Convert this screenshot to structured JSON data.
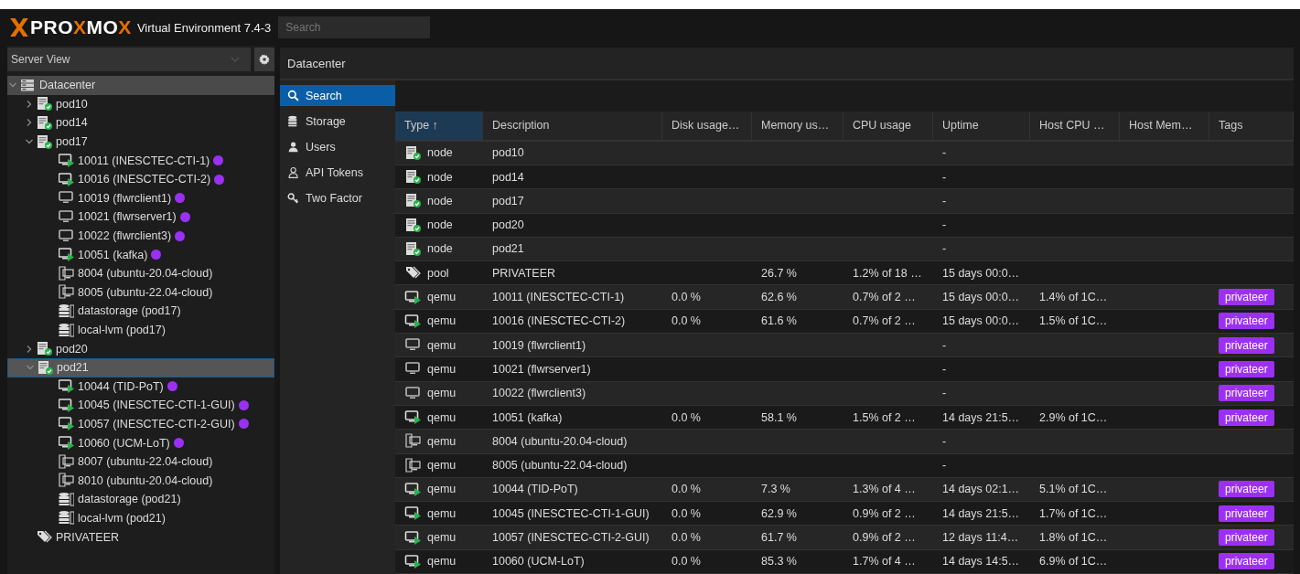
{
  "header": {
    "logo": [
      {
        "text": "PRO",
        "accent": false
      },
      {
        "text": "X",
        "accent": true
      },
      {
        "text": "MO",
        "accent": false
      },
      {
        "text": "X",
        "accent": true
      }
    ],
    "product": "Virtual Environment 7.4-3",
    "search": {
      "placeholder": "Search"
    }
  },
  "sidebar": {
    "view_selector": "Server View",
    "tree": {
      "label": "Datacenter",
      "kind": "datacenter",
      "expanded": true,
      "highlighted": true,
      "children": [
        {
          "label": "pod10",
          "kind": "node",
          "expanded": false,
          "selected": false
        },
        {
          "label": "pod14",
          "kind": "node",
          "expanded": false,
          "selected": false
        },
        {
          "label": "pod17",
          "kind": "node",
          "expanded": true,
          "selected": false,
          "children": [
            {
              "label": "10011 (INESCTEC-CTI-1)",
              "kind": "vm-running",
              "selected": false,
              "tags": [
                {
                  "color": "#9b30f5"
                }
              ]
            },
            {
              "label": "10016 (INESCTEC-CTI-2)",
              "kind": "vm-running",
              "selected": false,
              "tags": [
                {
                  "color": "#9b30f5"
                }
              ]
            },
            {
              "label": "10019 (flwrclient1)",
              "kind": "vm-stopped",
              "selected": false,
              "tags": [
                {
                  "color": "#9b30f5"
                }
              ]
            },
            {
              "label": "10021 (flwrserver1)",
              "kind": "vm-stopped",
              "selected": false,
              "tags": [
                {
                  "color": "#9b30f5"
                }
              ]
            },
            {
              "label": "10022 (flwrclient3)",
              "kind": "vm-stopped",
              "selected": false,
              "tags": [
                {
                  "color": "#9b30f5"
                }
              ]
            },
            {
              "label": "10051 (kafka)",
              "kind": "vm-running",
              "selected": false,
              "tags": [
                {
                  "color": "#9b30f5"
                }
              ]
            },
            {
              "label": "8004 (ubuntu-20.04-cloud)",
              "kind": "template",
              "selected": false
            },
            {
              "label": "8005 (ubuntu-22.04-cloud)",
              "kind": "template",
              "selected": false
            },
            {
              "label": "datastorage (pod17)",
              "kind": "storage",
              "selected": false
            },
            {
              "label": "local-lvm (pod17)",
              "kind": "storage",
              "selected": false
            }
          ]
        },
        {
          "label": "pod20",
          "kind": "node",
          "expanded": false,
          "selected": false
        },
        {
          "label": "pod21",
          "kind": "node",
          "expanded": true,
          "selected": true,
          "children": [
            {
              "label": "10044 (TID-PoT)",
              "kind": "vm-running",
              "selected": false,
              "tags": [
                {
                  "color": "#9b30f5"
                }
              ]
            },
            {
              "label": "10045 (INESCTEC-CTI-1-GUI)",
              "kind": "vm-running",
              "selected": false,
              "tags": [
                {
                  "color": "#9b30f5"
                }
              ]
            },
            {
              "label": "10057 (INESCTEC-CTI-2-GUI)",
              "kind": "vm-running",
              "selected": false,
              "tags": [
                {
                  "color": "#9b30f5"
                }
              ]
            },
            {
              "label": "10060 (UCM-LoT)",
              "kind": "vm-running",
              "selected": false,
              "tags": [
                {
                  "color": "#9b30f5"
                }
              ]
            },
            {
              "label": "8007 (ubuntu-22.04-cloud)",
              "kind": "template",
              "selected": false
            },
            {
              "label": "8010 (ubuntu-20.04-cloud)",
              "kind": "template",
              "selected": false
            },
            {
              "label": "datastorage (pod21)",
              "kind": "storage",
              "selected": false
            },
            {
              "label": "local-lvm (pod21)",
              "kind": "storage",
              "selected": false
            }
          ]
        },
        {
          "label": "PRIVATEER",
          "kind": "pool",
          "selected": false
        }
      ]
    }
  },
  "content": {
    "title": "Datacenter",
    "nav": [
      {
        "label": "Search",
        "kind": "search",
        "selected": true
      },
      {
        "label": "Storage",
        "kind": "storage",
        "selected": false
      },
      {
        "label": "Users",
        "kind": "user",
        "selected": false
      },
      {
        "label": "API Tokens",
        "kind": "token",
        "selected": false
      },
      {
        "label": "Two Factor",
        "kind": "key",
        "selected": false
      }
    ],
    "table": {
      "columns": [
        {
          "label": "Type ↑",
          "sorted": true
        },
        {
          "label": "Description",
          "sorted": false
        },
        {
          "label": "Disk usage…",
          "sorted": false
        },
        {
          "label": "Memory us…",
          "sorted": false
        },
        {
          "label": "CPU usage",
          "sorted": false
        },
        {
          "label": "Uptime",
          "sorted": false
        },
        {
          "label": "Host CPU …",
          "sorted": false
        },
        {
          "label": "Host Mem…",
          "sorted": false
        },
        {
          "label": "Tags",
          "sorted": false
        }
      ],
      "rows": [
        {
          "kind": "node",
          "type": "node",
          "description": "pod10",
          "uptime": "-"
        },
        {
          "kind": "node",
          "type": "node",
          "description": "pod14",
          "uptime": "-"
        },
        {
          "kind": "node",
          "type": "node",
          "description": "pod17",
          "uptime": "-"
        },
        {
          "kind": "node",
          "type": "node",
          "description": "pod20",
          "uptime": "-"
        },
        {
          "kind": "node",
          "type": "node",
          "description": "pod21",
          "uptime": "-"
        },
        {
          "kind": "pool",
          "type": "pool",
          "description": "PRIVATEER",
          "memory": "26.7 %",
          "cpu": "1.2% of 18 …",
          "uptime": "15 days 00:0…"
        },
        {
          "kind": "vm-running",
          "type": "qemu",
          "description": "10011 (INESCTEC-CTI-1)",
          "disk": "0.0 %",
          "memory": "62.6 %",
          "cpu": "0.7% of 2 …",
          "uptime": "15 days 00:0…",
          "host_cpu": "1.4% of 1C…",
          "tags": [
            "privateer"
          ]
        },
        {
          "kind": "vm-running",
          "type": "qemu",
          "description": "10016 (INESCTEC-CTI-2)",
          "disk": "0.0 %",
          "memory": "61.6 %",
          "cpu": "0.7% of 2 …",
          "uptime": "15 days 00:0…",
          "host_cpu": "1.5% of 1C…",
          "tags": [
            "privateer"
          ]
        },
        {
          "kind": "vm-stopped",
          "type": "qemu",
          "description": "10019 (flwrclient1)",
          "uptime": "-",
          "tags": [
            "privateer"
          ]
        },
        {
          "kind": "vm-stopped",
          "type": "qemu",
          "description": "10021 (flwrserver1)",
          "uptime": "-",
          "tags": [
            "privateer"
          ]
        },
        {
          "kind": "vm-stopped",
          "type": "qemu",
          "description": "10022 (flwrclient3)",
          "uptime": "-",
          "tags": [
            "privateer"
          ]
        },
        {
          "kind": "vm-running",
          "type": "qemu",
          "description": "10051 (kafka)",
          "disk": "0.0 %",
          "memory": "58.1 %",
          "cpu": "1.5% of 2 …",
          "uptime": "14 days 21:5…",
          "host_cpu": "2.9% of 1C…",
          "tags": [
            "privateer"
          ]
        },
        {
          "kind": "template",
          "type": "qemu",
          "description": "8004 (ubuntu-20.04-cloud)",
          "uptime": "-"
        },
        {
          "kind": "template",
          "type": "qemu",
          "description": "8005 (ubuntu-22.04-cloud)",
          "uptime": "-"
        },
        {
          "kind": "vm-running",
          "type": "qemu",
          "description": "10044 (TID-PoT)",
          "disk": "0.0 %",
          "memory": "7.3 %",
          "cpu": "1.3% of 4 …",
          "uptime": "14 days 02:1…",
          "host_cpu": "5.1% of 1C…",
          "tags": [
            "privateer"
          ]
        },
        {
          "kind": "vm-running",
          "type": "qemu",
          "description": "10045 (INESCTEC-CTI-1-GUI)",
          "disk": "0.0 %",
          "memory": "62.9 %",
          "cpu": "0.9% of 2 …",
          "uptime": "14 days 21:5…",
          "host_cpu": "1.7% of 1C…",
          "tags": [
            "privateer"
          ]
        },
        {
          "kind": "vm-running",
          "type": "qemu",
          "description": "10057 (INESCTEC-CTI-2-GUI)",
          "disk": "0.0 %",
          "memory": "61.7 %",
          "cpu": "0.9% of 2 …",
          "uptime": "12 days 11:4…",
          "host_cpu": "1.8% of 1C…",
          "tags": [
            "privateer"
          ]
        },
        {
          "kind": "vm-running",
          "type": "qemu",
          "description": "10060 (UCM-LoT)",
          "disk": "0.0 %",
          "memory": "85.3 %",
          "cpu": "1.7% of 4 …",
          "uptime": "14 days 14:5…",
          "host_cpu": "6.9% of 1C…",
          "tags": [
            "privateer"
          ]
        }
      ]
    }
  }
}
